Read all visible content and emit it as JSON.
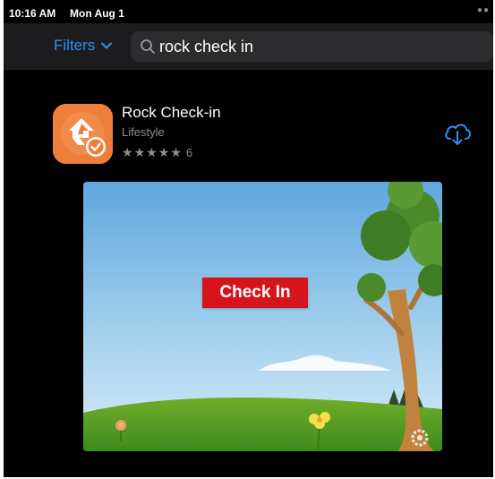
{
  "status_bar": {
    "time": "10:16 AM",
    "date": "Mon Aug 1"
  },
  "header": {
    "filters_label": "Filters",
    "search_query": "rock check in"
  },
  "app": {
    "name": "Rock Check-in",
    "category": "Lifestyle",
    "rating_stars": 5,
    "rating_count": "6",
    "icon_color": "#ee7f3b"
  },
  "preview": {
    "button_label": "Check In",
    "button_color": "#d7141c"
  },
  "colors": {
    "accent": "#2f8ef7",
    "background": "#000000",
    "header": "#1c1c1e"
  }
}
